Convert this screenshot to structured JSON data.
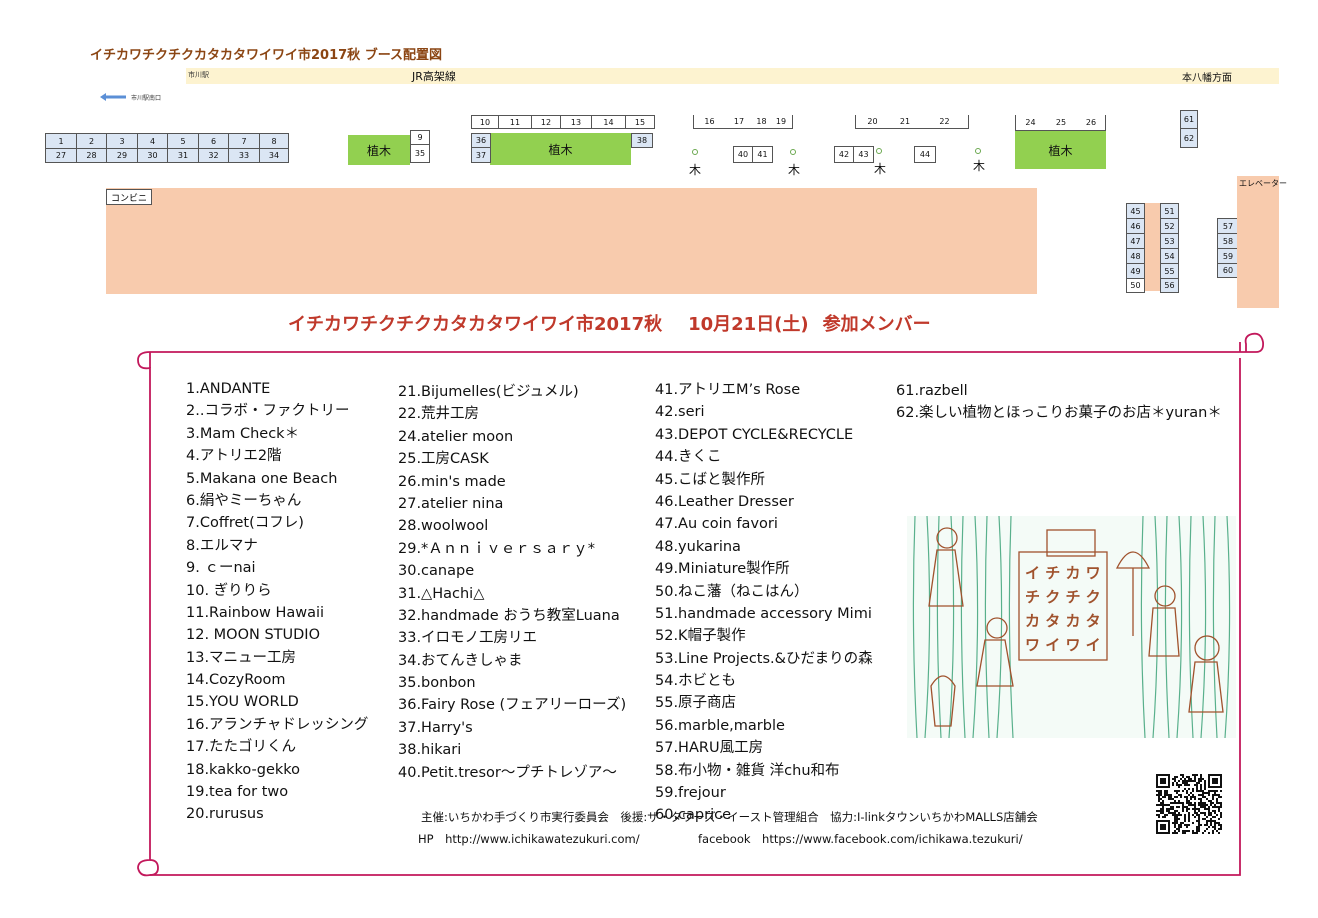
{
  "map": {
    "title": "イチカワチクチクカタカタワイワイ市2017秋 ブース配置図",
    "rail_label": "JR高架線",
    "rail_left": "市川駅",
    "rail_right": "本八幡方面",
    "station_exit": "市川駅南口",
    "convenience_store": "コンビニ",
    "elevator": "エレベーター",
    "plant_label": "植木",
    "tree_label": "木"
  },
  "booths": {
    "row_a_top": [
      "1",
      "2",
      "3",
      "4",
      "5",
      "6",
      "7",
      "8"
    ],
    "row_a_bottom": [
      "27",
      "28",
      "29",
      "30",
      "31",
      "32",
      "33",
      "34"
    ],
    "pair_9_35": [
      "9",
      "35"
    ],
    "row_b_top": [
      "10",
      "11",
      "12",
      "13",
      "14",
      "15"
    ],
    "row_b_left": [
      "36",
      "37"
    ],
    "row_b_right": "38",
    "row_c": [
      "16",
      "17",
      "18",
      "19"
    ],
    "pair_40_41": [
      "40",
      "41"
    ],
    "row_d": [
      "20",
      "21",
      "22"
    ],
    "pair_42_43": [
      "42",
      "43"
    ],
    "booth_44": "44",
    "row_e": [
      "24",
      "25",
      "26"
    ],
    "pair_61_62": [
      "61",
      "62"
    ],
    "block_left": [
      "45",
      "46",
      "47",
      "48",
      "49",
      "50"
    ],
    "block_right": [
      "51",
      "52",
      "53",
      "54",
      "55",
      "56"
    ],
    "block_far": [
      "57",
      "58",
      "59",
      "60"
    ]
  },
  "heading": {
    "title": "イチカワチクチクカタカタワイワイ市2017秋",
    "date": "10月21日(土)",
    "members": "参加メンバー"
  },
  "members": {
    "col1": [
      "1.ANDANTE",
      "2..コラボ・ファクトリー",
      "3.Mam Check＊",
      "4.アトリエ2階",
      "5.Makana one Beach",
      "6.絹やミーちゃん",
      "7.Coffret(コフレ)",
      "8.エルマナ",
      "9. ｃーnai",
      "10. ぎりりら",
      "11.Rainbow Hawaii",
      "12. MOON STUDIO",
      "13.マニュー工房",
      "14.CozyRoom",
      "15.YOU WORLD",
      "16.アランチャドレッシング",
      "17.たたゴリくん",
      "18.kakko-gekko",
      "19.tea for two",
      "20.rurusus"
    ],
    "col2": [
      "21.Bijumelles(ビジュメル)",
      "22.荒井工房",
      "24.atelier moon",
      "25.工房CASK",
      "26.min's made",
      "27.atelier nina",
      "28.woolwool",
      "29.*Ａｎｎｉｖｅｒｓａｒｙ*",
      "30.canape",
      "31.△Hachi△",
      "32.handmade おうち教室Luana",
      "33.イロモノ工房リエ",
      "34.おてんきしゃま",
      "35.bonbon",
      "36.Fairy Rose (フェアリーローズ)",
      "37.Harry's",
      "38.hikari",
      "40.Petit.tresor～プチトレゾア～"
    ],
    "col3": [
      "41.アトリエM’s Rose",
      "42.seri",
      "43.DEPOT CYCLE&RECYCLE",
      "44.きくこ",
      "45.こばと製作所",
      "46.Leather Dresser",
      "47.Au coin favori",
      "48.yukarina",
      "49.Miniature製作所",
      "50.ねこ藩（ねこはん）",
      "51.handmade accessory Mimi",
      "52.K帽子製作",
      "53.Line Projects.&ひだまりの森",
      "54.ホビとも",
      "55.原子商店",
      "56.marble,marble",
      "57.HARU風工房",
      "58.布小物・雑貨 洋chu和布",
      "59.frejour",
      "60.caprice"
    ],
    "col4": [
      "61.razbell",
      "62.楽しい植物とほっこりお菓子のお店＊yuran＊"
    ]
  },
  "footer": {
    "organizer": "主催:いちかわ手づくり市実行委員会　後援:ザ・タワーズ・イースト管理組合　協力:I-linkタウンいちかわMALLS店舗会",
    "hp": "HP　http://www.ichikawatezukuri.com/",
    "facebook": "facebook　https://www.facebook.com/ichikawa.tezukuri/"
  },
  "colors": {
    "plant": "#92d050",
    "booth": "#dbe6f4",
    "convenience": "#f8cbad",
    "scroll_border": "#c2185b",
    "heading": "#c0392b"
  },
  "icons": [
    "left-arrow-icon",
    "tree-icon",
    "qr-code-icon",
    "poster-illustration"
  ]
}
